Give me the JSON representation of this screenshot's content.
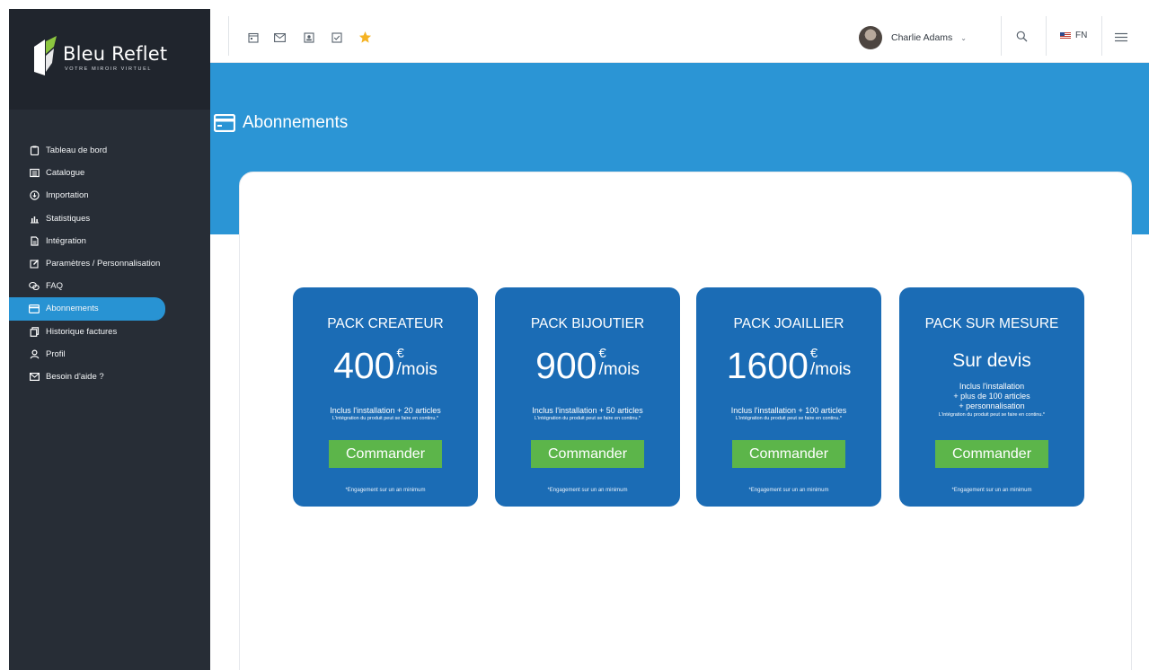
{
  "brand": {
    "name": "Bleu Reflet",
    "tagline": "VOTRE MIROIR VIRTUEL"
  },
  "sidebar": {
    "items": [
      {
        "label": "Tableau de bord",
        "icon": "clipboard-icon"
      },
      {
        "label": "Catalogue",
        "icon": "list-icon"
      },
      {
        "label": "Importation",
        "icon": "download-circle-icon"
      },
      {
        "label": "Statistiques",
        "icon": "bar-chart-icon"
      },
      {
        "label": "Intégration",
        "icon": "document-icon"
      },
      {
        "label": "Paramètres / Personnalisation",
        "icon": "edit-icon"
      },
      {
        "label": "FAQ",
        "icon": "chat-icon"
      },
      {
        "label": "Abonnements",
        "icon": "credit-card-icon",
        "active": true
      },
      {
        "label": "Historique factures",
        "icon": "copy-icon"
      },
      {
        "label": "Profil",
        "icon": "user-icon"
      },
      {
        "label": "Besoin d'aide ?",
        "icon": "mail-icon"
      }
    ]
  },
  "topbar": {
    "icons": [
      "calendar-icon",
      "mail-icon",
      "contact-icon",
      "checkbox-icon",
      "star-icon"
    ],
    "user_name": "Charlie Adams",
    "language": "FN"
  },
  "page": {
    "title": "Abonnements"
  },
  "plans": [
    {
      "title": "PACK CREATEUR",
      "price": "400",
      "currency": "€",
      "period": "/mois",
      "includes": "Inclus l'installation + 20 articles",
      "note": "L'intégration du produit peut se faire en continu.*",
      "button": "Commander",
      "engagement": "*Engagement sur un an minimum"
    },
    {
      "title": "PACK BIJOUTIER",
      "price": "900",
      "currency": "€",
      "period": "/mois",
      "includes": "Inclus l'installation + 50 articles",
      "note": "L'intégration du produit peut se faire en continu.*",
      "button": "Commander",
      "engagement": "*Engagement sur un an minimum"
    },
    {
      "title": "PACK JOAILLIER",
      "price": "1600",
      "currency": "€",
      "period": "/mois",
      "includes": "Inclus l'installation + 100 articles",
      "note": "L'intégration du produit peut se faire en continu.*",
      "button": "Commander",
      "engagement": "*Engagement sur un an minimum"
    },
    {
      "title": "PACK SUR MESURE",
      "quote": "Sur devis",
      "includes_lines": [
        "Inclus l'installation",
        "+ plus de 100 articles",
        "+ personnalisation"
      ],
      "note": "L'intégration du produit peut se faire en continu.*",
      "button": "Commander",
      "engagement": "*Engagement sur un an minimum"
    }
  ],
  "colors": {
    "sidebar": "#272d36",
    "accent": "#2b95d5",
    "card": "#1b6cb5",
    "button": "#5cb54a",
    "star": "#f5b324"
  }
}
